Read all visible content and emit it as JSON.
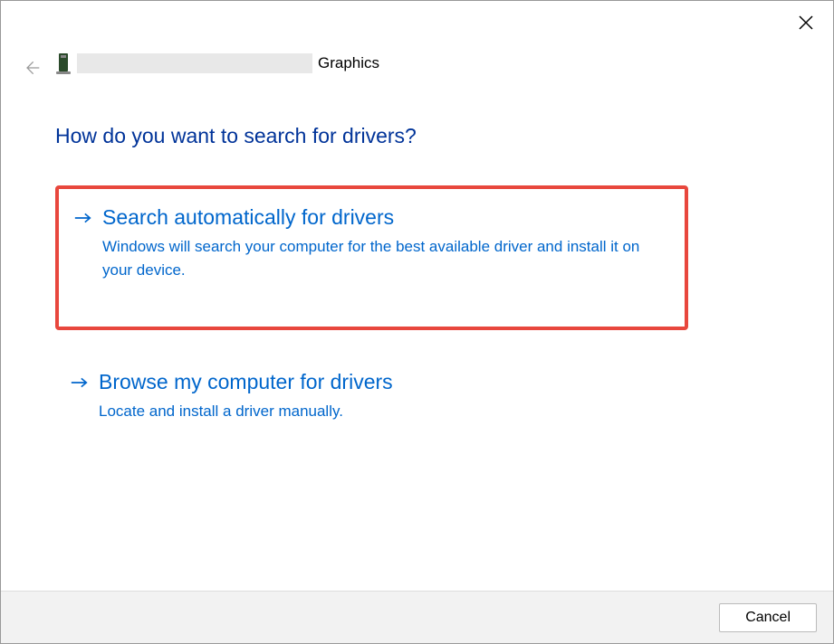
{
  "header": {
    "device_suffix": "Graphics"
  },
  "page_title": "How do you want to search for drivers?",
  "options": [
    {
      "title": "Search automatically for drivers",
      "description": "Windows will search your computer for the best available driver and install it on your device.",
      "highlighted": true
    },
    {
      "title": "Browse my computer for drivers",
      "description": "Locate and install a driver manually.",
      "highlighted": false
    }
  ],
  "footer": {
    "cancel_label": "Cancel"
  }
}
